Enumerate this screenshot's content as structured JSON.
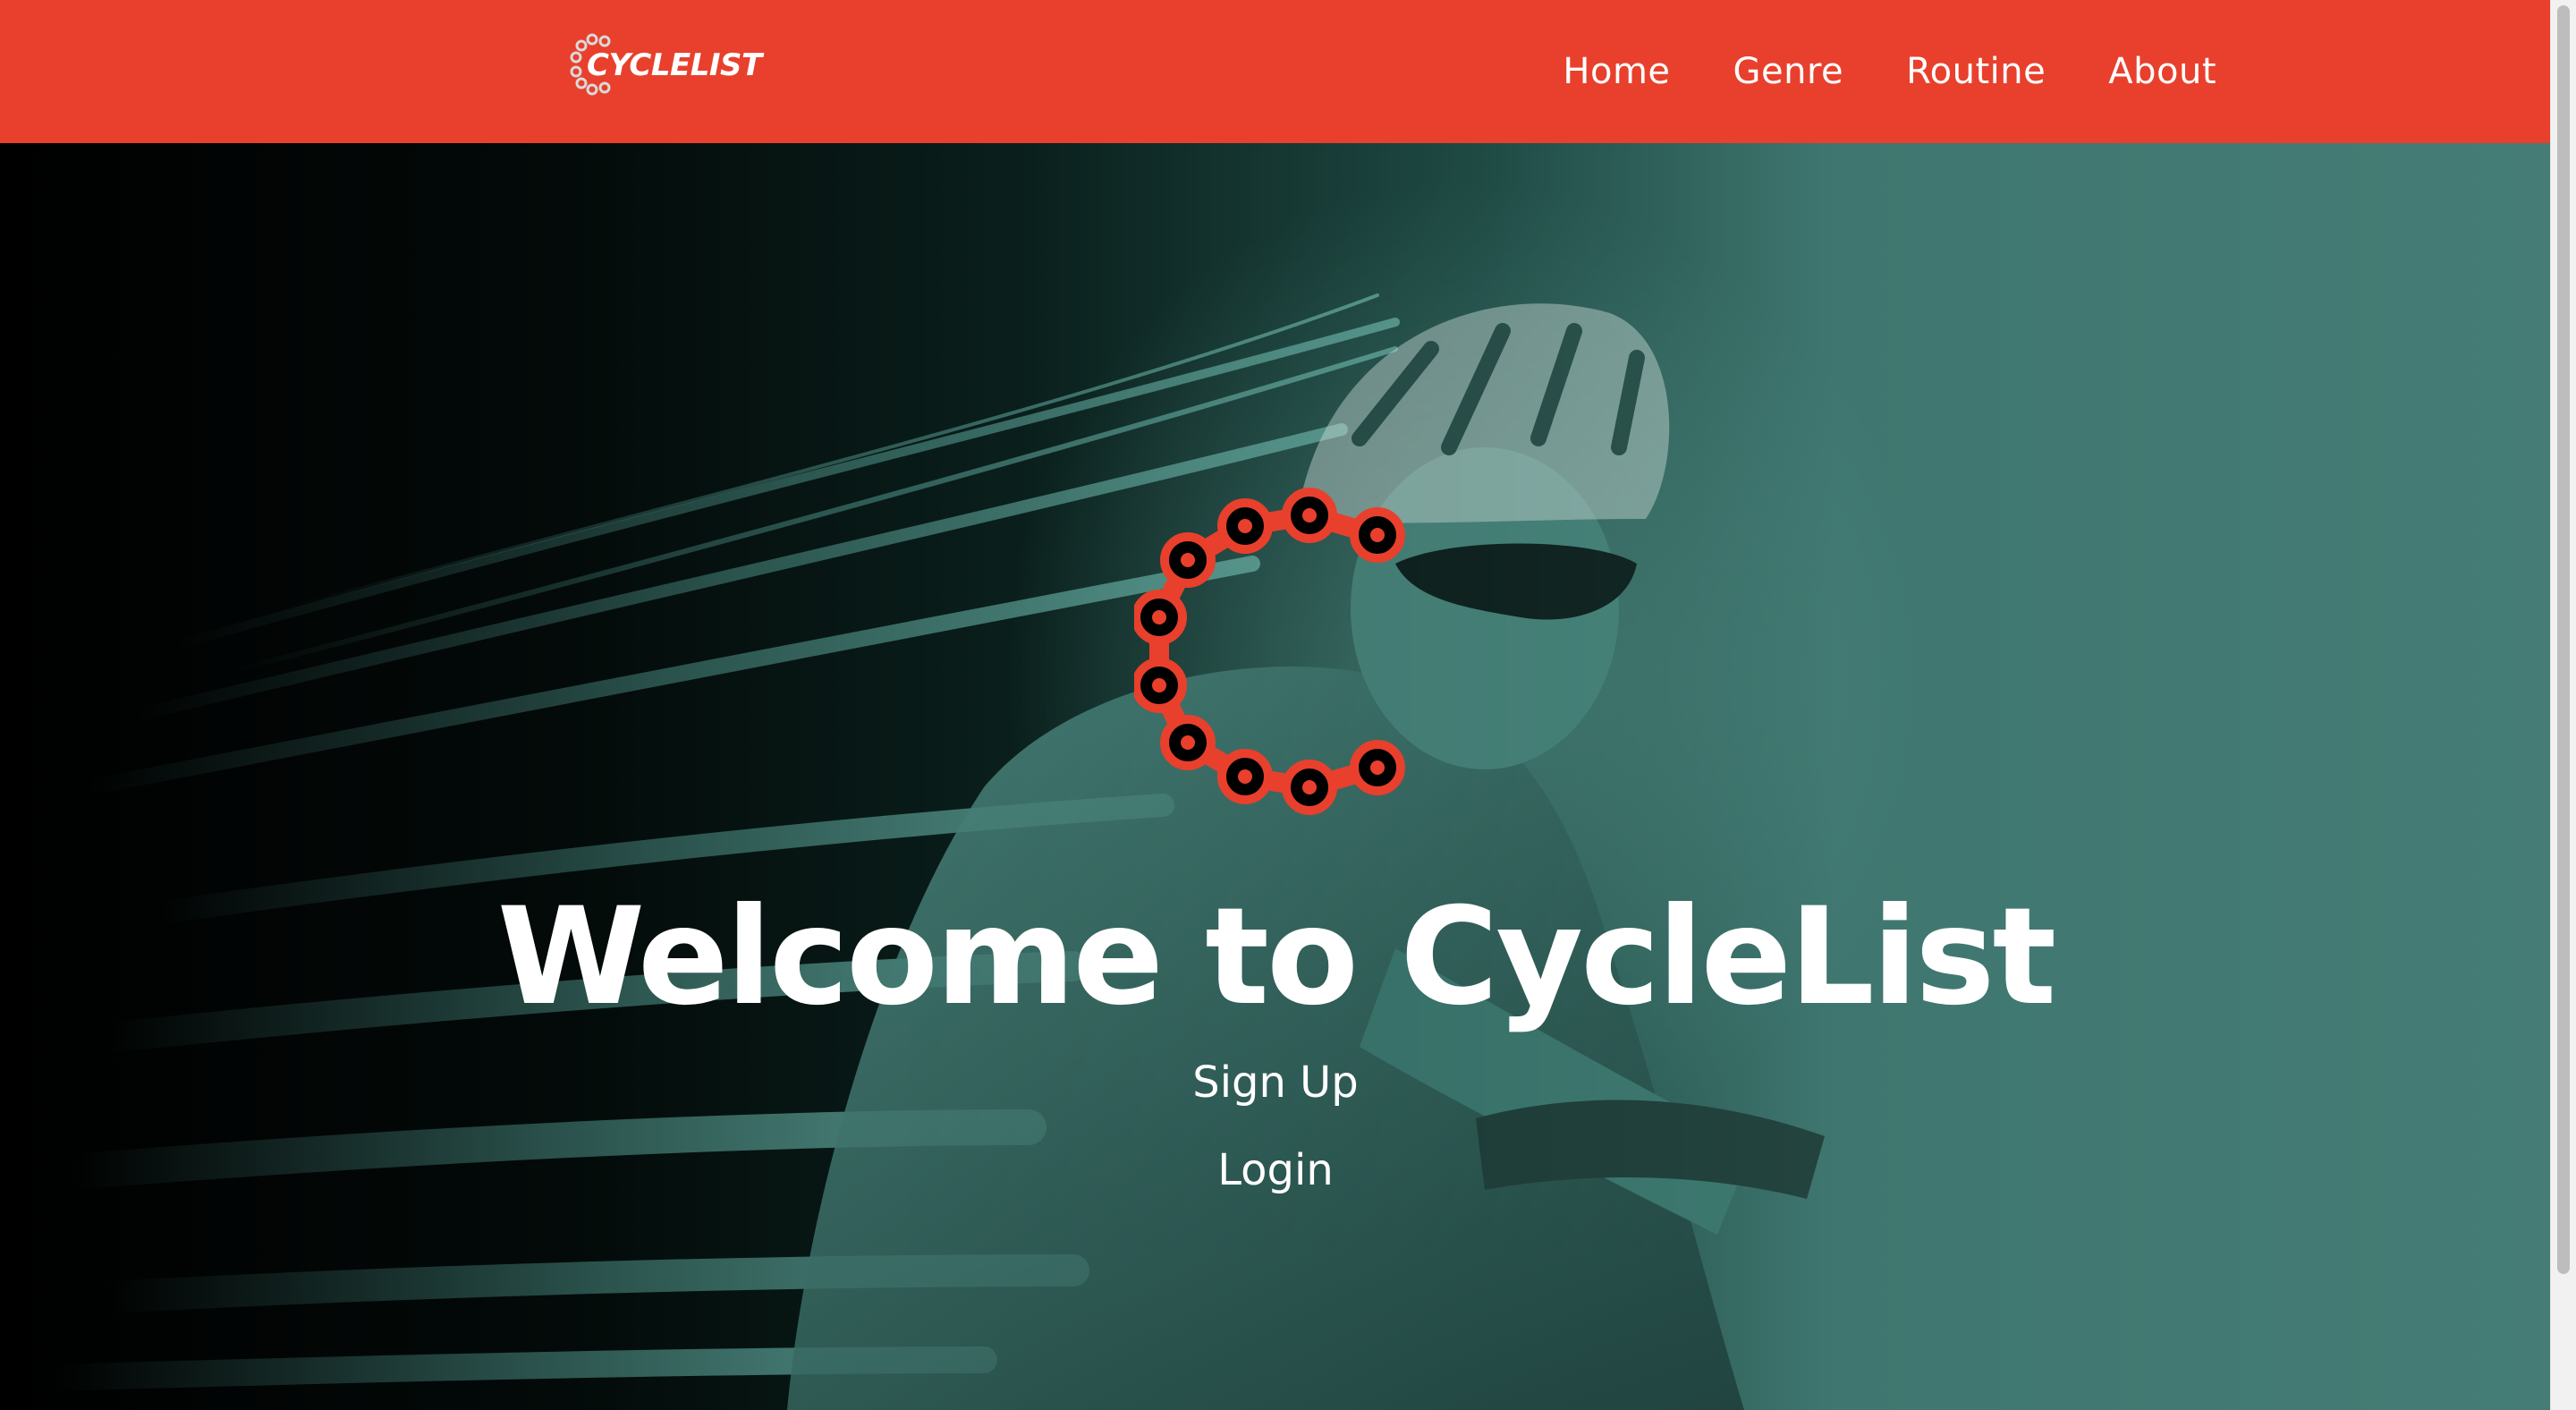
{
  "navbar": {
    "brand": "CYCLELIST",
    "links": [
      {
        "label": "Home"
      },
      {
        "label": "Genre"
      },
      {
        "label": "Routine"
      },
      {
        "label": "About"
      }
    ]
  },
  "hero": {
    "title": "Welcome to CycleList",
    "signup_label": "Sign Up",
    "login_label": "Login",
    "logo_icon": "chain-c-logo-icon"
  },
  "colors": {
    "accent": "#e8402c",
    "hero_teal": "#457d76",
    "hero_dark": "#000000",
    "text": "#ffffff"
  }
}
